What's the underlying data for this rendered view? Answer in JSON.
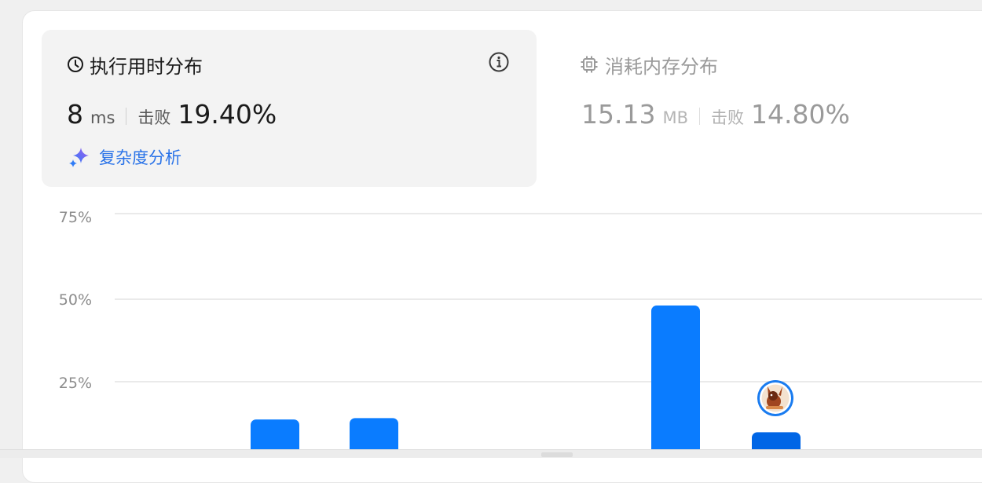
{
  "runtime": {
    "title": "执行用时分布",
    "value": "8",
    "unit": "ms",
    "beat_label": "击败",
    "beat_percent": "19.40%",
    "complexity_label": "复杂度分析"
  },
  "memory": {
    "title": "消耗内存分布",
    "value": "15.13",
    "unit": "MB",
    "beat_label": "击败",
    "beat_percent": "14.80%"
  },
  "icons": {
    "runtime": "clock-icon",
    "info": "info-icon",
    "complexity": "sparkle-icon",
    "memory": "chip-icon",
    "user": "user-avatar"
  },
  "colors": {
    "bar": "#0a7cff",
    "bar_selected": "#0066e6",
    "complexity_text": "#2a73e8",
    "muted": "#9a9a9a"
  },
  "chart_data": {
    "type": "bar",
    "yticks": [
      "75%",
      "50%",
      "25%"
    ],
    "ylim": [
      0,
      75
    ],
    "grid": true,
    "values": [
      13.3,
      13.7,
      47.2,
      9.5
    ],
    "selected_index": 3
  }
}
